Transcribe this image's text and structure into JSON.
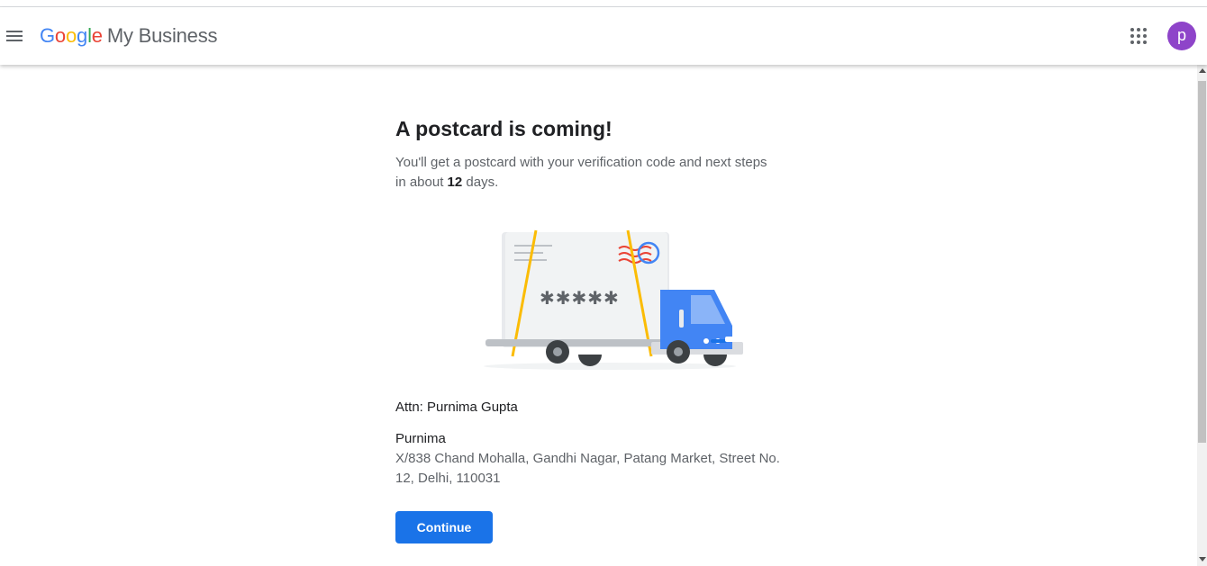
{
  "header": {
    "logo_letters": [
      "G",
      "o",
      "o",
      "g",
      "l",
      "e"
    ],
    "product_name": "My Business",
    "avatar_initial": "p"
  },
  "main": {
    "title": "A postcard is coming!",
    "description_before": "You'll get a postcard with your verification code and next steps in about ",
    "days": "12",
    "description_after": " days.",
    "postcard_code_mask": "✱✱✱✱✱",
    "attention": "Attn: Purnima Gupta",
    "address_name": "Purnima",
    "address_line": "X/838 Chand Mohalla, Gandhi Nagar, Patang Market, Street No. 12, Delhi, 110031",
    "continue_label": "Continue"
  },
  "colors": {
    "primary_button": "#1a73e8",
    "avatar": "#8e44c9",
    "truck_blue": "#4285f4",
    "strap_yellow": "#fbbc05",
    "postmark_red": "#ea4335"
  }
}
